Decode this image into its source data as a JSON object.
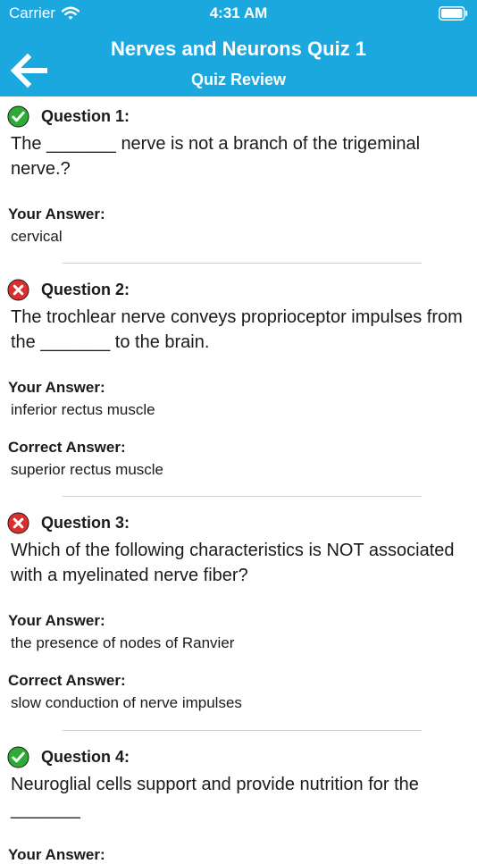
{
  "status_bar": {
    "carrier": "Carrier",
    "time": "4:31 AM"
  },
  "nav": {
    "title": "Nerves and Neurons Quiz 1",
    "subtitle": "Quiz Review"
  },
  "labels": {
    "your_answer": "Your Answer:",
    "correct_answer": "Correct Answer:"
  },
  "colors": {
    "header": "#1ba8df",
    "correct": "#2eaa37",
    "wrong": "#d9302f"
  },
  "questions": [
    {
      "number": "Question 1:",
      "status": "correct",
      "text": "The _______ nerve is not a branch of the trigeminal nerve.?",
      "your_answer": "cervical"
    },
    {
      "number": "Question 2:",
      "status": "wrong",
      "text": "The trochlear nerve conveys proprioceptor impulses from the _______ to the brain.",
      "your_answer": "inferior rectus muscle",
      "correct_answer": "superior rectus muscle"
    },
    {
      "number": "Question 3:",
      "status": "wrong",
      "text": "Which of the following characteristics is NOT associated with a myelinated nerve fiber?",
      "your_answer": "the presence of nodes of Ranvier",
      "correct_answer": "slow conduction of nerve impulses"
    },
    {
      "number": "Question 4:",
      "status": "correct",
      "text": "Neuroglial cells support and provide nutrition for the _______",
      "your_answer": ""
    }
  ]
}
